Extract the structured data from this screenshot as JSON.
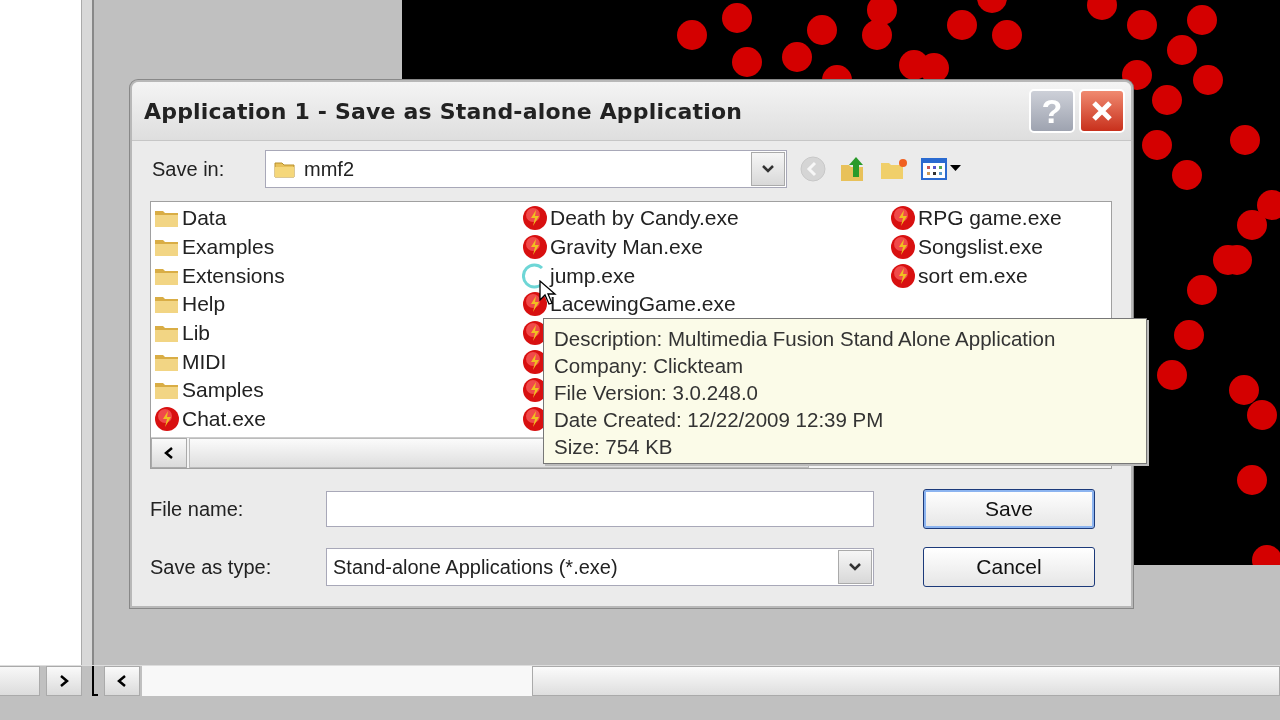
{
  "dialog": {
    "title": "Application 1 - Save as Stand-alone Application",
    "title_buttons": [
      {
        "kind": "help",
        "label": "?"
      },
      {
        "kind": "close"
      }
    ],
    "save_in": {
      "label": "Save in:",
      "value": "mmf2"
    },
    "toolbar": [
      {
        "kind": "back",
        "disabled": true
      },
      {
        "kind": "up",
        "disabled": false
      },
      {
        "kind": "newfolder",
        "disabled": false
      },
      {
        "kind": "views",
        "disabled": false
      }
    ],
    "files": [
      {
        "kind": "folder",
        "name": "Data"
      },
      {
        "kind": "folder",
        "name": "Examples"
      },
      {
        "kind": "folder",
        "name": "Extensions"
      },
      {
        "kind": "folder",
        "name": "Help"
      },
      {
        "kind": "folder",
        "name": "Lib"
      },
      {
        "kind": "folder",
        "name": "MIDI"
      },
      {
        "kind": "folder",
        "name": "Samples"
      },
      {
        "kind": "exe",
        "name": "Chat.exe"
      },
      {
        "kind": "exe",
        "name": "Death by Candy.exe"
      },
      {
        "kind": "exe",
        "name": "Gravity Man.exe"
      },
      {
        "kind": "loading",
        "name": "jump.exe"
      },
      {
        "kind": "exe",
        "name": "LacewingGame.exe"
      },
      {
        "kind": "exe"
      },
      {
        "kind": "exe"
      },
      {
        "kind": "exe"
      },
      {
        "kind": "exe"
      },
      {
        "kind": "exe",
        "name": "RPG game.exe"
      },
      {
        "kind": "exe",
        "name": "Songslist.exe"
      },
      {
        "kind": "exe",
        "name": "sort em.exe"
      }
    ],
    "tooltip": {
      "lines": [
        "Description: Multimedia Fusion Stand Alone Application",
        "Company: Clickteam",
        "File Version: 3.0.248.0",
        "Date Created: 12/22/2009 12:39 PM",
        "Size: 754 KB"
      ]
    },
    "file_name": {
      "label": "File name:"
    },
    "save_as_type": {
      "label": "Save as type:",
      "value": "Stand-alone Applications (*.exe)"
    },
    "buttons": [
      {
        "label": "Save",
        "default": true
      },
      {
        "label": "Cancel",
        "default": false
      }
    ]
  }
}
